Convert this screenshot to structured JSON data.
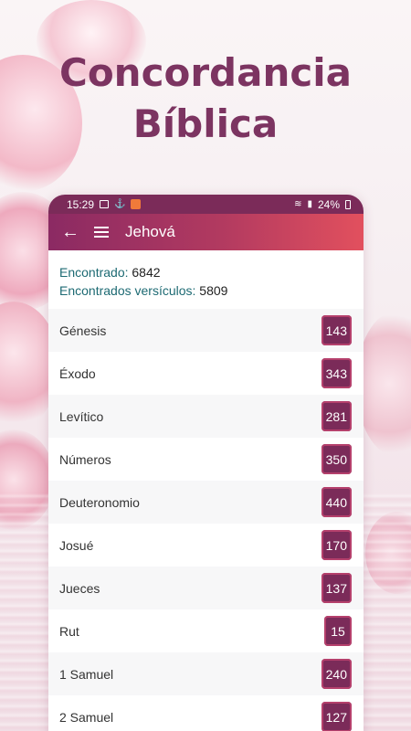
{
  "headline": {
    "line1": "Concordancia",
    "line2": "Bíblica"
  },
  "status_bar": {
    "time": "15:29",
    "signal": "24%",
    "icons": [
      "image-icon",
      "download-icon",
      "app-icon",
      "wifi-icon",
      "signal-icon",
      "battery-icon"
    ]
  },
  "app_bar": {
    "back_icon": "arrow-left-icon",
    "menu_icon": "hamburger-menu-icon",
    "title": "Jehová"
  },
  "summary": {
    "found_label": "Encontrado:",
    "found_value": "6842",
    "verses_label": "Encontrados versículos:",
    "verses_value": "5809"
  },
  "books": [
    {
      "name": "Génesis",
      "count": "143"
    },
    {
      "name": "Éxodo",
      "count": "343"
    },
    {
      "name": "Levítico",
      "count": "281"
    },
    {
      "name": "Números",
      "count": "350"
    },
    {
      "name": "Deuteronomio",
      "count": "440"
    },
    {
      "name": "Josué",
      "count": "170"
    },
    {
      "name": "Jueces",
      "count": "137"
    },
    {
      "name": "Rut",
      "count": "15"
    },
    {
      "name": "1 Samuel",
      "count": "240"
    },
    {
      "name": "2 Samuel",
      "count": "127"
    }
  ],
  "colors": {
    "accent": "#7b2b59",
    "appbar_start": "#8b2a63",
    "appbar_end": "#e2505e",
    "label": "#1d6a73"
  }
}
